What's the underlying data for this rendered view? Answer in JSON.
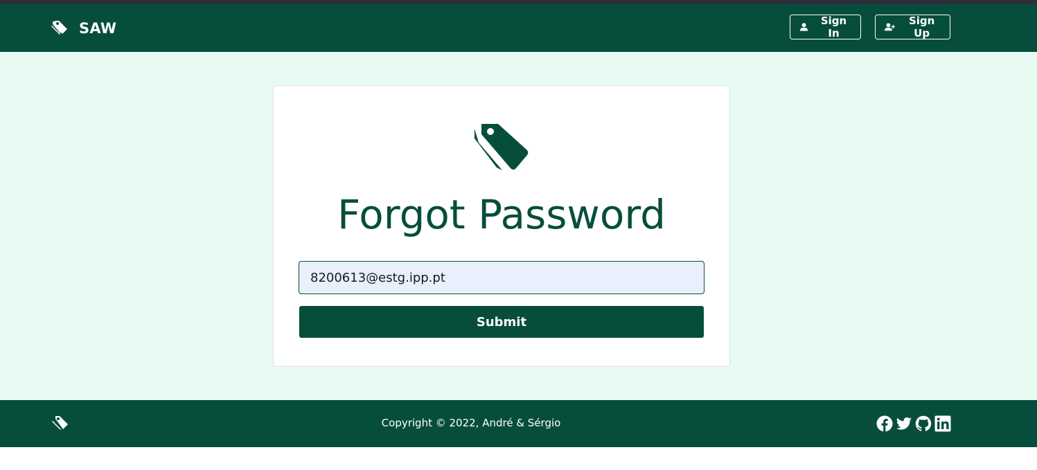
{
  "navbar": {
    "brand_name": "SAW",
    "brand_icon": "tags-icon",
    "sign_in_label": "Sign In",
    "sign_in_icon": "user-icon",
    "sign_up_label": "Sign Up",
    "sign_up_icon": "user-plus-icon"
  },
  "form": {
    "icon": "tags-icon",
    "title": "Forgot Password",
    "email_value": "8200613@estg.ipp.pt",
    "submit_label": "Submit"
  },
  "footer": {
    "logo_icon": "tags-icon",
    "copyright": "Copyright © 2022, André & Sérgio",
    "socials": [
      "facebook-icon",
      "twitter-icon",
      "github-icon",
      "linkedin-icon"
    ]
  },
  "colors": {
    "primary": "#064e3b",
    "page_background": "#e8fbf3",
    "input_background": "#e8effd"
  }
}
